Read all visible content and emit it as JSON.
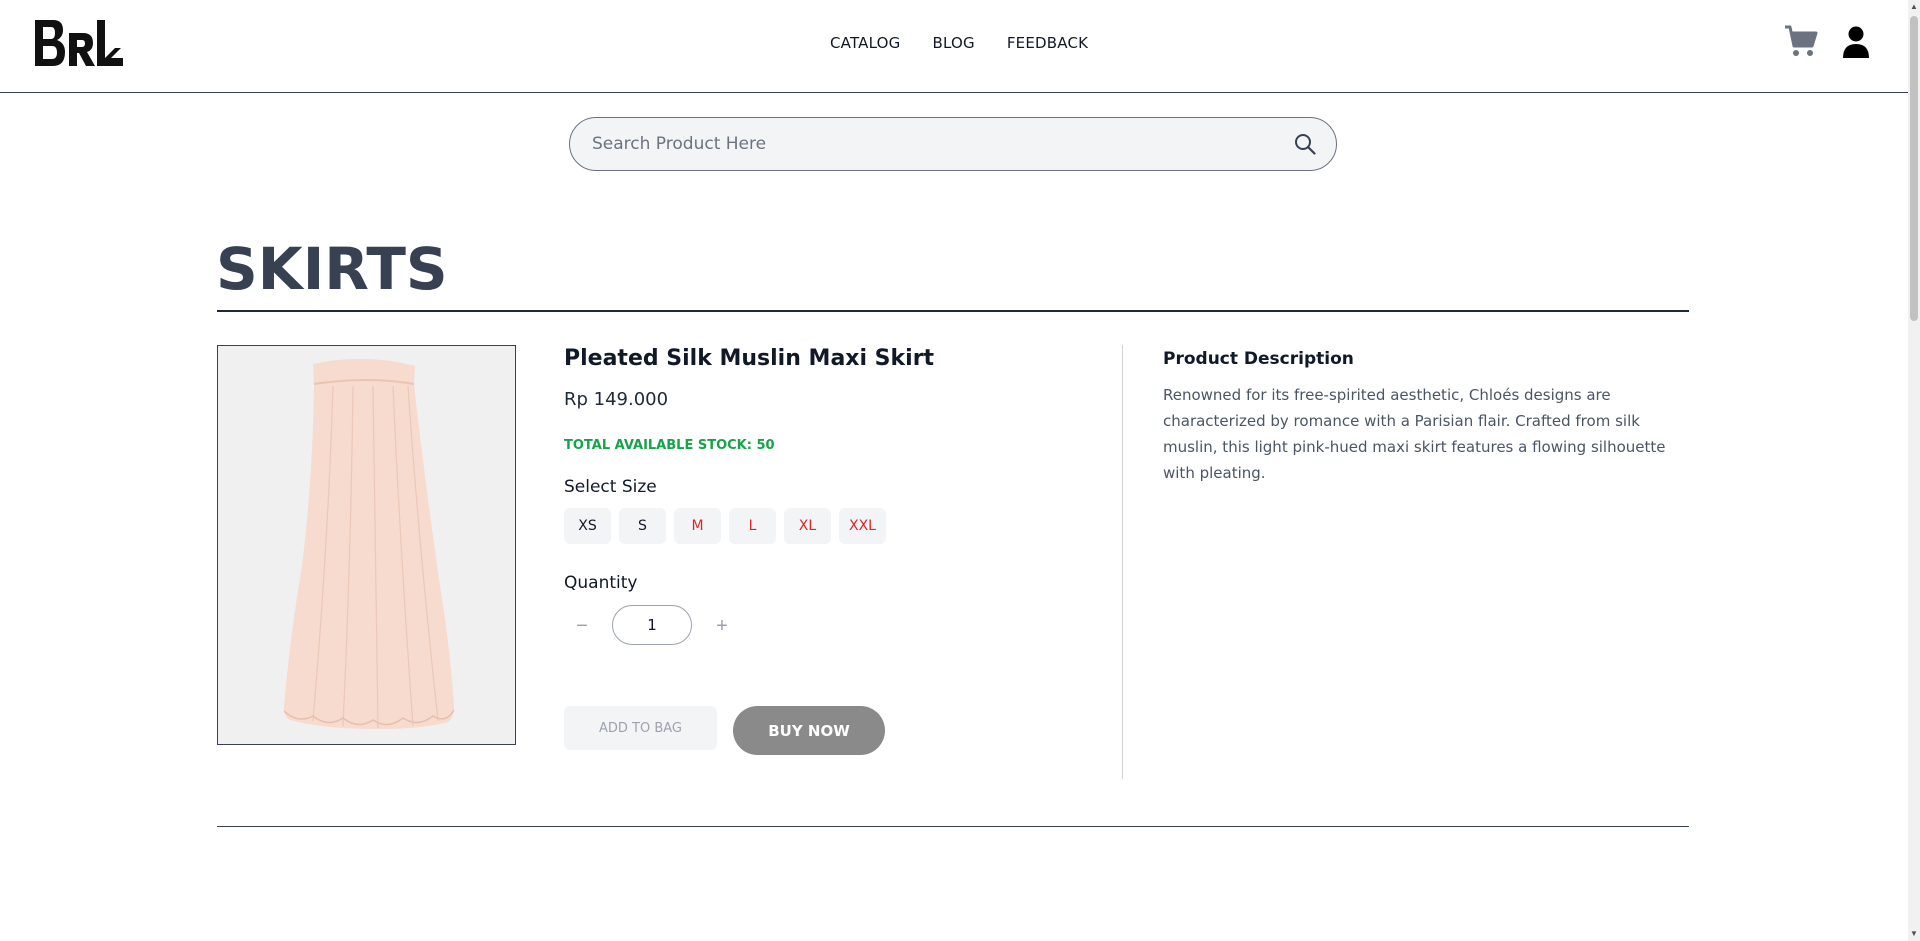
{
  "header": {
    "logo_alt": "BRL",
    "nav": [
      {
        "label": "CATALOG"
      },
      {
        "label": "BLOG"
      },
      {
        "label": "FEEDBACK"
      }
    ],
    "icons": [
      "cart-icon",
      "user-icon"
    ]
  },
  "search": {
    "placeholder": "Search Product Here",
    "value": ""
  },
  "category": {
    "title": "SKIRTS"
  },
  "product": {
    "name": "Pleated Silk Muslin Maxi Skirt",
    "price": "Rp 149.000",
    "stock_text": "TOTAL AVAILABLE STOCK: 50",
    "image_color": "#f6d8cb",
    "size_label": "Select Size",
    "sizes": [
      {
        "label": "XS",
        "available": true
      },
      {
        "label": "S",
        "available": true
      },
      {
        "label": "M",
        "available": false
      },
      {
        "label": "L",
        "available": false
      },
      {
        "label": "XL",
        "available": false
      },
      {
        "label": "XXL",
        "available": false
      }
    ],
    "quantity_label": "Quantity",
    "quantity": "1",
    "add_to_bag_label": "ADD TO BAG",
    "buy_now_label": "BUY NOW"
  },
  "description": {
    "title": "Product Description",
    "text": "Renowned for its free-spirited aesthetic, Chloés designs are characterized by romance with a Parisian flair. Crafted from silk muslin, this light pink-hued maxi skirt features a flowing silhouette with pleating."
  },
  "colors": {
    "stock_green": "#16a34a",
    "out_of_stock_red": "#dc2626",
    "buy_now_bg": "#8a8a8a"
  }
}
